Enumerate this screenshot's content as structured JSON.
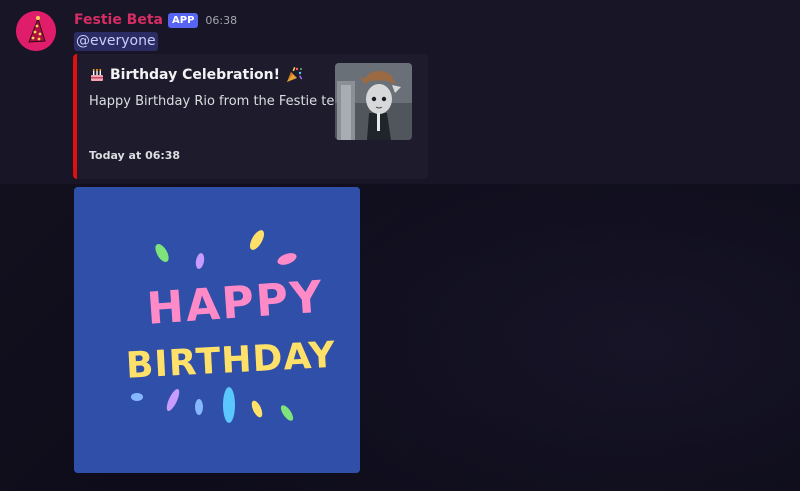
{
  "message": {
    "author": "Festie Beta",
    "badge": "APP",
    "time": "06:38",
    "content": "@everyone"
  },
  "embed": {
    "title": "Birthday Celebration!",
    "title_icon_left": "cake-icon",
    "title_icon_right": "party-popper-icon",
    "description": "Happy Birthday Rio from the Festie team",
    "footer": "Today at 06:38",
    "accent_color": "#e01010",
    "thumbnail_icon": "character-thumbnail"
  },
  "attachment": {
    "line1": "HAPPY",
    "line2": "BIRTHDAY",
    "background_color": "#2f4fa8"
  },
  "colors": {
    "author": "#d62d63",
    "badge": "#5865f2",
    "mention_bg": "#3b4170"
  }
}
